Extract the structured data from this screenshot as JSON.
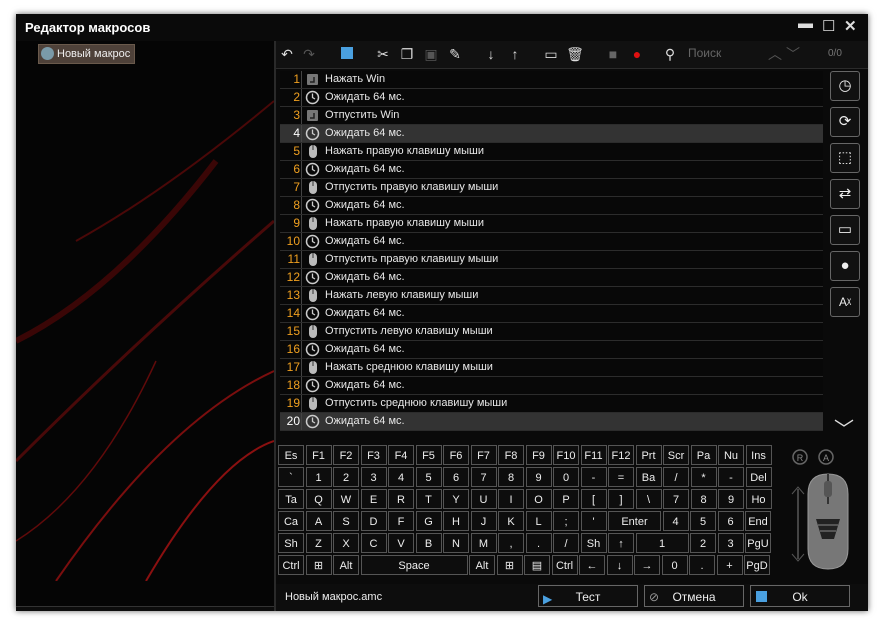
{
  "window": {
    "title": "Редактор макросов"
  },
  "tree": {
    "item_label": "Новый макрос"
  },
  "search": {
    "placeholder": "Поиск"
  },
  "counter": "0/0",
  "list": [
    {
      "num": "1",
      "text": "Нажать Win",
      "icon": "key-press-icon"
    },
    {
      "num": "2",
      "text": "Ожидать 64 мс.",
      "icon": "clock-icon"
    },
    {
      "num": "3",
      "text": "Отпустить Win",
      "icon": "key-press-icon"
    },
    {
      "num": "4",
      "text": "Ожидать 64 мс.",
      "icon": "clock-icon"
    },
    {
      "num": "5",
      "text": "Нажать правую клавишу мыши",
      "icon": "mouse-icon"
    },
    {
      "num": "6",
      "text": "Ожидать 64 мс.",
      "icon": "clock-icon"
    },
    {
      "num": "7",
      "text": "Отпустить правую клавишу мыши",
      "icon": "mouse-icon"
    },
    {
      "num": "8",
      "text": "Ожидать 64 мс.",
      "icon": "clock-icon"
    },
    {
      "num": "9",
      "text": "Нажать правую клавишу мыши",
      "icon": "mouse-icon"
    },
    {
      "num": "10",
      "text": "Ожидать 64 мс.",
      "icon": "clock-icon"
    },
    {
      "num": "11",
      "text": "Отпустить правую клавишу мыши",
      "icon": "mouse-icon"
    },
    {
      "num": "12",
      "text": "Ожидать 64 мс.",
      "icon": "clock-icon"
    },
    {
      "num": "13",
      "text": "Нажать левую клавишу мыши",
      "icon": "mouse-icon"
    },
    {
      "num": "14",
      "text": "Ожидать 64 мс.",
      "icon": "clock-icon"
    },
    {
      "num": "15",
      "text": "Отпустить левую клавишу мыши",
      "icon": "mouse-icon"
    },
    {
      "num": "16",
      "text": "Ожидать 64 мс.",
      "icon": "clock-icon"
    },
    {
      "num": "17",
      "text": "Нажать среднюю клавишу мыши",
      "icon": "mouse-icon"
    },
    {
      "num": "18",
      "text": "Ожидать 64 мс.",
      "icon": "clock-icon"
    },
    {
      "num": "19",
      "text": "Отпустить среднюю клавишу мыши",
      "icon": "mouse-icon"
    },
    {
      "num": "20",
      "text": "Ожидать 64 мс.",
      "icon": "clock-icon"
    }
  ],
  "keyboard": {
    "rows": [
      [
        "Es",
        "F1",
        "F2",
        "F3",
        "F4",
        "F5",
        "F6",
        "F7",
        "F8",
        "F9",
        "F10",
        "F11",
        "F12",
        "Prt",
        "Scr",
        "Pa",
        "Nu",
        "Ins"
      ],
      [
        "`",
        "1",
        "2",
        "3",
        "4",
        "5",
        "6",
        "7",
        "8",
        "9",
        "0",
        "-",
        "=",
        "Ba",
        "/",
        "*",
        "-",
        "Del"
      ],
      [
        "Ta",
        "Q",
        "W",
        "E",
        "R",
        "T",
        "Y",
        "U",
        "I",
        "O",
        "P",
        "[",
        "]",
        "\\",
        "7",
        "8",
        "9",
        "Ho"
      ],
      [
        "Ca",
        "A",
        "S",
        "D",
        "F",
        "G",
        "H",
        "J",
        "K",
        "L",
        ";",
        "'",
        "Enter",
        "4",
        "5",
        "6",
        "End"
      ],
      [
        "Sh",
        "Z",
        "X",
        "C",
        "V",
        "B",
        "N",
        "M",
        ",",
        ".",
        "/",
        "Sh",
        "↑",
        "1",
        "2",
        "3",
        "PgU"
      ],
      [
        "Ctrl",
        "",
        "Alt",
        "Space",
        "Alt",
        "",
        "",
        "Ctrl",
        "←",
        "↓",
        "→",
        "0",
        ".",
        "+",
        "PgD"
      ]
    ]
  },
  "bottom": {
    "filename": "Новый макрос.amc",
    "test_label": "Тест",
    "cancel_label": "Отмена",
    "ok_label": "Ok"
  },
  "colors": {
    "accent_orange": "#f0a020",
    "record_red": "#e01010",
    "bg": "#000000"
  }
}
